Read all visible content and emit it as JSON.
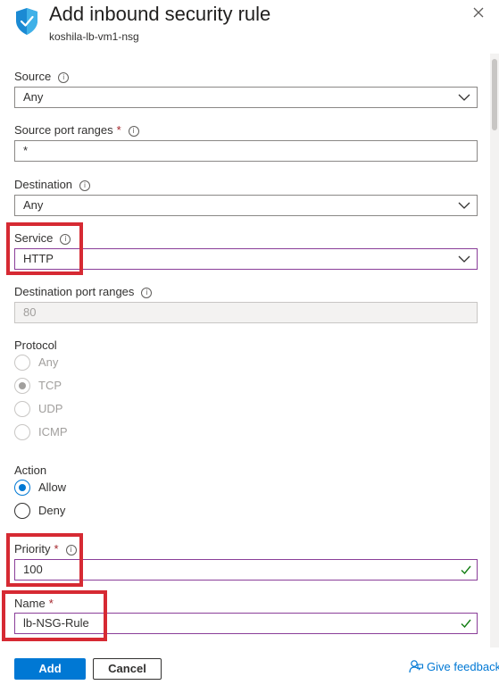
{
  "header": {
    "title": "Add inbound security rule",
    "subtitle": "koshila-lb-vm1-nsg"
  },
  "form": {
    "source": {
      "label": "Source",
      "value": "Any"
    },
    "source_port_ranges": {
      "label": "Source port ranges",
      "required": "*",
      "value": "*"
    },
    "destination": {
      "label": "Destination",
      "value": "Any"
    },
    "service": {
      "label": "Service",
      "value": "HTTP"
    },
    "destination_port_ranges": {
      "label": "Destination port ranges",
      "value": "80"
    },
    "protocol": {
      "label": "Protocol",
      "options": [
        "Any",
        "TCP",
        "UDP",
        "ICMP"
      ],
      "selected": "TCP"
    },
    "action": {
      "label": "Action",
      "options": [
        "Allow",
        "Deny"
      ],
      "selected": "Allow"
    },
    "priority": {
      "label": "Priority",
      "required": "*",
      "value": "100"
    },
    "name": {
      "label": "Name",
      "required": "*",
      "value": "lb-NSG-Rule"
    }
  },
  "footer": {
    "add_label": "Add",
    "cancel_label": "Cancel",
    "feedback_label": "Give feedback"
  },
  "colors": {
    "accent": "#0078d4",
    "highlight": "#d62a33",
    "focus_border": "#8a3e99",
    "valid_check": "#107c10"
  }
}
